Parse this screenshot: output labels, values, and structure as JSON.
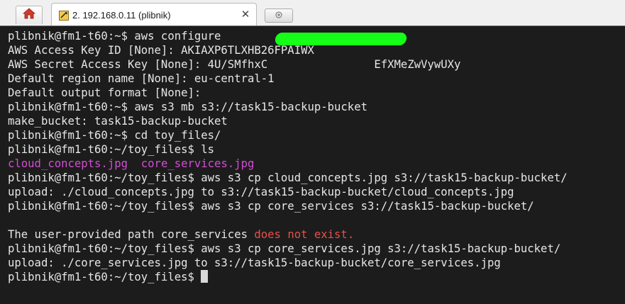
{
  "tabbar": {
    "active_tab_title": "2. 192.168.0.11 (plibnik)",
    "home_icon": "home-icon",
    "tab_icon": "terminal-session-icon",
    "close_icon": "close-icon",
    "new_tab_icon": "new-tab-icon"
  },
  "colors": {
    "terminal_bg": "#1c1c1c",
    "terminal_fg": "#e6e6e6",
    "filename_purple": "#d44cd4",
    "error_red": "#e8504a",
    "redaction_green": "#16ff18"
  },
  "terminal": {
    "lines": [
      {
        "text": "plibnik@fm1-t60:~$ aws configure"
      },
      {
        "text": "AWS Access Key ID [None]: AKIAXP6TLXHB26FPAIWX"
      },
      {
        "pre": "AWS Secret Access Key [None]: 4U/SMfhxC",
        "post": "EfXMeZwVywUXy"
      },
      {
        "text": "Default region name [None]: eu-central-1"
      },
      {
        "text": "Default output format [None]:"
      },
      {
        "text": "plibnik@fm1-t60:~$ aws s3 mb s3://task15-backup-bucket"
      },
      {
        "text": "make_bucket: task15-backup-bucket"
      },
      {
        "text": "plibnik@fm1-t60:~$ cd toy_files/"
      },
      {
        "text": "plibnik@fm1-t60:~/toy_files$ ls"
      },
      {
        "file1": "cloud_concepts.jpg",
        "file2": "core_services.jpg"
      },
      {
        "text": "plibnik@fm1-t60:~/toy_files$ aws s3 cp cloud_concepts.jpg s3://task15-backup-bucket/"
      },
      {
        "text": "upload: ./cloud_concepts.jpg to s3://task15-backup-bucket/cloud_concepts.jpg"
      },
      {
        "text": "plibnik@fm1-t60:~/toy_files$ aws s3 cp core_services s3://task15-backup-bucket/"
      },
      {
        "text": ""
      },
      {
        "pre": "The user-provided path core_services ",
        "error": "does not exist",
        "post": "."
      },
      {
        "text": "plibnik@fm1-t60:~/toy_files$ aws s3 cp core_services.jpg s3://task15-backup-bucket/"
      },
      {
        "text": "upload: ./core_services.jpg to s3://task15-backup-bucket/core_services.jpg"
      },
      {
        "prompt": "plibnik@fm1-t60:~/toy_files$ "
      }
    ]
  }
}
